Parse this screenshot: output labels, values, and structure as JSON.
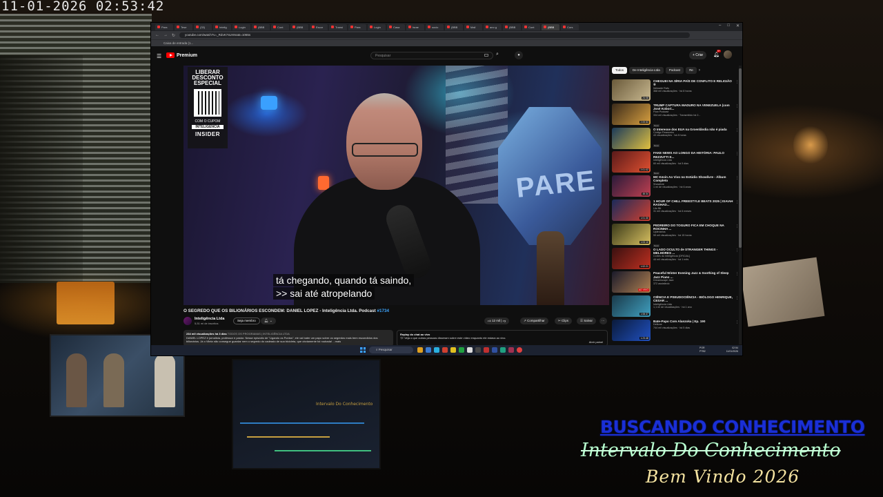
{
  "overlay": {
    "timestamp": "11-01-2026  02:53:42",
    "title": "BUSCANDO CONHECIMENTO",
    "subtitle": "Intervalo Do Conhecimento",
    "welcome": "Bem Vindo 2026"
  },
  "browser": {
    "tabs": [
      "Para",
      "Tese",
      "(33)",
      "Intelig",
      "Login",
      "(BBB",
      "Cont",
      "(BBB",
      "Escor",
      "Transi",
      "Para",
      "Login",
      "Casa",
      "Israe",
      "socio",
      "(BBB",
      "Mail",
      "ano g",
      "(BBB",
      "Cont",
      "(BBB",
      "Curs"
    ],
    "active_tab_index": 20,
    "url": "youtube.com/watch?v=_RdvK74LNNc&t=1065s",
    "bookmark": "Caixa de entrada (1..."
  },
  "youtube": {
    "logo": "Premium",
    "search_placeholder": "Pesquisar",
    "create_label": "+ Criar",
    "bell_badge": "9+",
    "video": {
      "title": "O SEGREDO QUE OS BILIONÁRIOS ESCONDEM: DANIEL LOPEZ - Inteligência Ltda. Podcast",
      "tag": "#1734",
      "subtitle_line1": "tá chegando, quando tá saindo,",
      "subtitle_line2": ">> sai até atropelando",
      "promo_title": "LIBERAR DESCONTO ESPECIAL",
      "promo_cupom": "COM O CUPOM",
      "promo_code": "INTELIGENCIA",
      "promo_brand": "INSIDER"
    },
    "channel": {
      "name": "Inteligência Ltda",
      "subs": "5,51 mi de inscritos",
      "join_label": "Seja membro"
    },
    "actions": {
      "likes": "12 mil",
      "share": "Compartilhar",
      "clip": "Clips",
      "save": "Salvar",
      "more": "⋯"
    },
    "description": {
      "meta": "234 mil visualizações  há 3 dias",
      "tags": "TODOS OS PROGRAMAS | INTELIGÊNCIA LTDA",
      "text": "DANIEL LOPEZ é jornalista, professor e pastor. Nesse episódio de \"Ligando os Pontos\", ele vai bater um papo sobre os segredos mais bem escondidos dos bilionários. Já o Vilela não consegue guardar nem o segredo do cadeado de sua bicicleta, que obviamente foi roubada! ...mais"
    },
    "chat": {
      "title": "Replay do chat ao vivo",
      "text": "Veja o que outras pessoas disseram sobre este vídeo enquanto ele estava ao vivo.",
      "open": "Abrir painel"
    },
    "side_note": [
      "28°C",
      "Pred. nublado"
    ],
    "chips": [
      "Todos",
      "De Inteligência Ltda",
      "Podcast",
      "Re"
    ],
    "recommendations": [
      {
        "title": "CHEGUEI NA SÍRIA PAÍS DE CONFLITO E RELIGIÃO ✡",
        "channel": "Ildimarte Rafo",
        "views": "368 mil visualizações · há 8 horas",
        "duration": "24:08",
        "badge": "",
        "color1": "#6a5a3a",
        "color2": "#c8b890"
      },
      {
        "title": "TRUMP CAPTURA MADURO NA VENEZUELA (com José Kobori...",
        "channel": "Flow Podcast",
        "views": "334 mil visualizações · Transmitido há 2...",
        "duration": "2:09:53",
        "badge": "Novo",
        "color1": "#3a2a1a",
        "color2": "#d8a040"
      },
      {
        "title": "O Interesse dos EUA na Groenlândia não é piada",
        "channel": "Código Financeiro",
        "views": "43 visualizações · há 8 horas",
        "duration": "",
        "badge": "Novo",
        "color1": "#1a3a5a",
        "color2": "#e0c040"
      },
      {
        "title": "FAKE NEWS AO LONGO DA HISTÓRIA: PAULO REZZUTTI E...",
        "channel": "Inteligência Ltda",
        "views": "60 mil visualizações · há 5 dias",
        "duration": "2:01:02",
        "badge": "Novo",
        "color1": "#5a1a1a",
        "color2": "#e05030"
      },
      {
        "title": "MC Kevin Ao Vivo no Estúdio Showlivre - Álbum Completo",
        "channel": "Showlivre",
        "views": "1 mi de visualizações · há 6 anos",
        "duration": "45:34",
        "badge": "",
        "color1": "#2a1a3a",
        "color2": "#c04050"
      },
      {
        "title": "1 HOUR OF CHILL FREESTYLE BEATS 2025 | ISAIAH RASHAD...",
        "channel": "Lito Bit",
        "views": "31 mil visualizações · há 6 meses",
        "duration": "1:01:30",
        "badge": "",
        "color1": "#1a2a5a",
        "color2": "#d04030"
      },
      {
        "title": "PEDREIRO DO TOGURO FICA EM CHOQUE NA ROCINHA ...",
        "channel": "Uplenarios",
        "views": "59 mil visualizações · há 15 horas",
        "duration": "1:03:10",
        "badge": "Novo",
        "color1": "#3a3a1a",
        "color2": "#d8c060"
      },
      {
        "title": "O LADO OCULTO de STRANGER THINGS - MELHORES ...",
        "channel": "Cortes do Inteligência [OFICIAL]",
        "views": "44 mil visualizações · há 1 mês",
        "duration": "1:02:21",
        "badge": "",
        "color1": "#3a1010",
        "color2": "#c03020"
      },
      {
        "title": "Peaceful Winter Evening Jazz & Soothing of Sleep Jazz Piano ...",
        "channel": "Dreamscape Jazz",
        "views": "372 assistindo",
        "duration": "AO VIVO",
        "badge": "",
        "color1": "#1a1a2a",
        "color2": "#b08050"
      },
      {
        "title": "CIÊNCIA E PSEUDOCIÊNCIA - BIÓLOGO HENRIQUE, CESAR ...",
        "channel": "Inteligência Ltda",
        "views": "1,1 mi de visualizações · há 1 ano",
        "duration": "1:08:37",
        "badge": "",
        "color1": "#1a3a4a",
        "color2": "#40a0c0"
      },
      {
        "title": "Bate-Papo Com Alanzoka | Ep. 190",
        "channel": "Deltone",
        "views": "744 mil visualizações · há 5 dias",
        "duration": "1:23:48",
        "badge": "",
        "color1": "#0a1a3a",
        "color2": "#2050c0"
      }
    ]
  },
  "taskbar": {
    "search": "Pesquisar",
    "lang": [
      "POR",
      "PTB2"
    ],
    "time": "02:54",
    "date": "11/01/2026"
  }
}
